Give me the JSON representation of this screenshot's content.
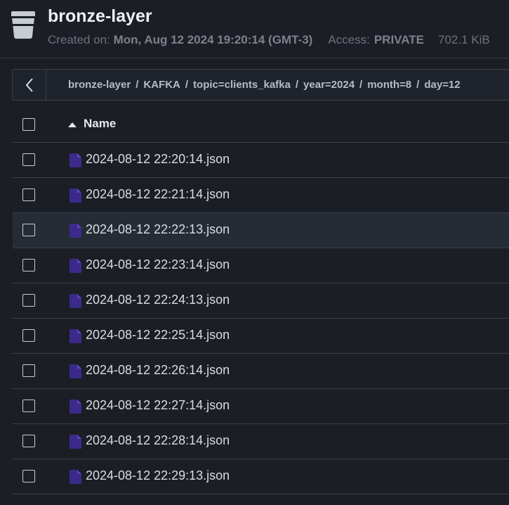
{
  "bucket": {
    "title": "bronze-layer",
    "created_label": "Created on:",
    "created_value": "Mon, Aug 12 2024 19:20:14 (GMT-3)",
    "access_label": "Access:",
    "access_value": "PRIVATE",
    "size_value": "702.1 KiB"
  },
  "breadcrumb": {
    "items": [
      "bronze-layer",
      "KAFKA",
      "topic=clients_kafka",
      "year=2024",
      "month=8",
      "day=12"
    ],
    "separator": "/"
  },
  "table": {
    "column_name": "Name",
    "sort_direction": "ascending",
    "files": [
      "2024-08-12 22:20:14.json",
      "2024-08-12 22:21:14.json",
      "2024-08-12 22:22:13.json",
      "2024-08-12 22:23:14.json",
      "2024-08-12 22:24:13.json",
      "2024-08-12 22:25:14.json",
      "2024-08-12 22:26:14.json",
      "2024-08-12 22:27:14.json",
      "2024-08-12 22:28:14.json",
      "2024-08-12 22:29:13.json"
    ],
    "highlighted_index": 2
  },
  "colors": {
    "background": "#1b1e25",
    "row_highlight": "#262c35",
    "file_icon": "#3b2a8a",
    "border": "#3a404a"
  },
  "icons": {
    "bucket": "bucket-icon",
    "back": "chevron-left-icon",
    "sort": "sort-ascending-icon",
    "file": "file-icon"
  }
}
